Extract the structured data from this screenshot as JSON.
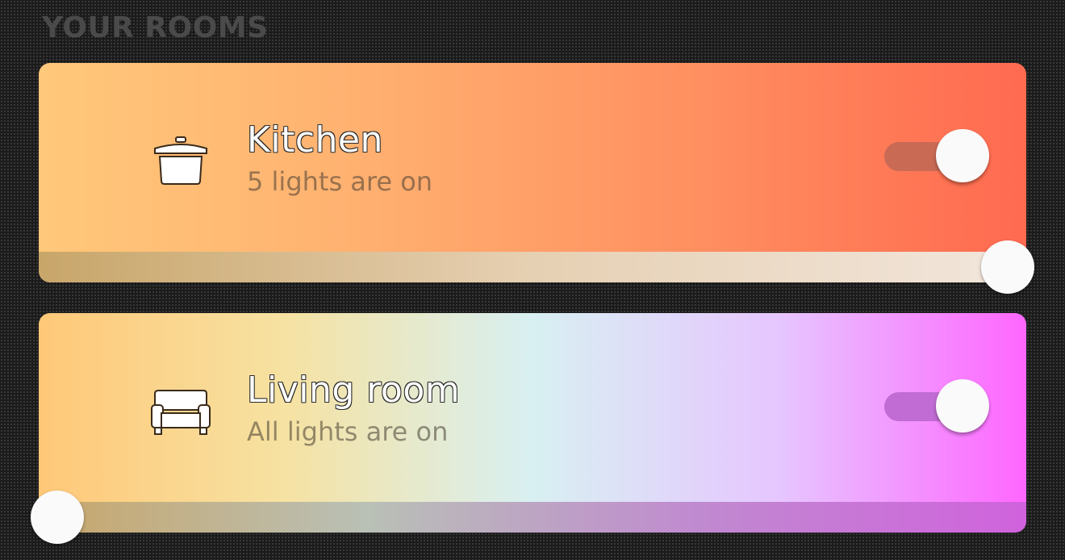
{
  "section_title": "YOUR ROOMS",
  "rooms": [
    {
      "name": "Kitchen",
      "status": "5 lights are on",
      "icon": "cooking-pot-icon",
      "on": true,
      "brightness": 1.0,
      "colors": {
        "gradient": [
          "#ffc87a",
          "#ffb070",
          "#ff8f60",
          "#ff6a50"
        ],
        "toggle_track": "#c96a55",
        "slider": [
          "#c8a66a",
          "#e6d0b3",
          "#f2e6dc"
        ]
      }
    },
    {
      "name": "Living room",
      "status": "All lights are on",
      "icon": "sofa-icon",
      "on": true,
      "brightness": 0.0,
      "colors": {
        "gradient": [
          "#ffc878",
          "#f6e2a2",
          "#d8f0f2",
          "#e6c6ff",
          "#ff66ff"
        ],
        "toggle_track": "#c16bd4",
        "slider": [
          "#c8a66a",
          "#b9c0b6",
          "#c08ad0",
          "#d062dd"
        ]
      }
    }
  ]
}
